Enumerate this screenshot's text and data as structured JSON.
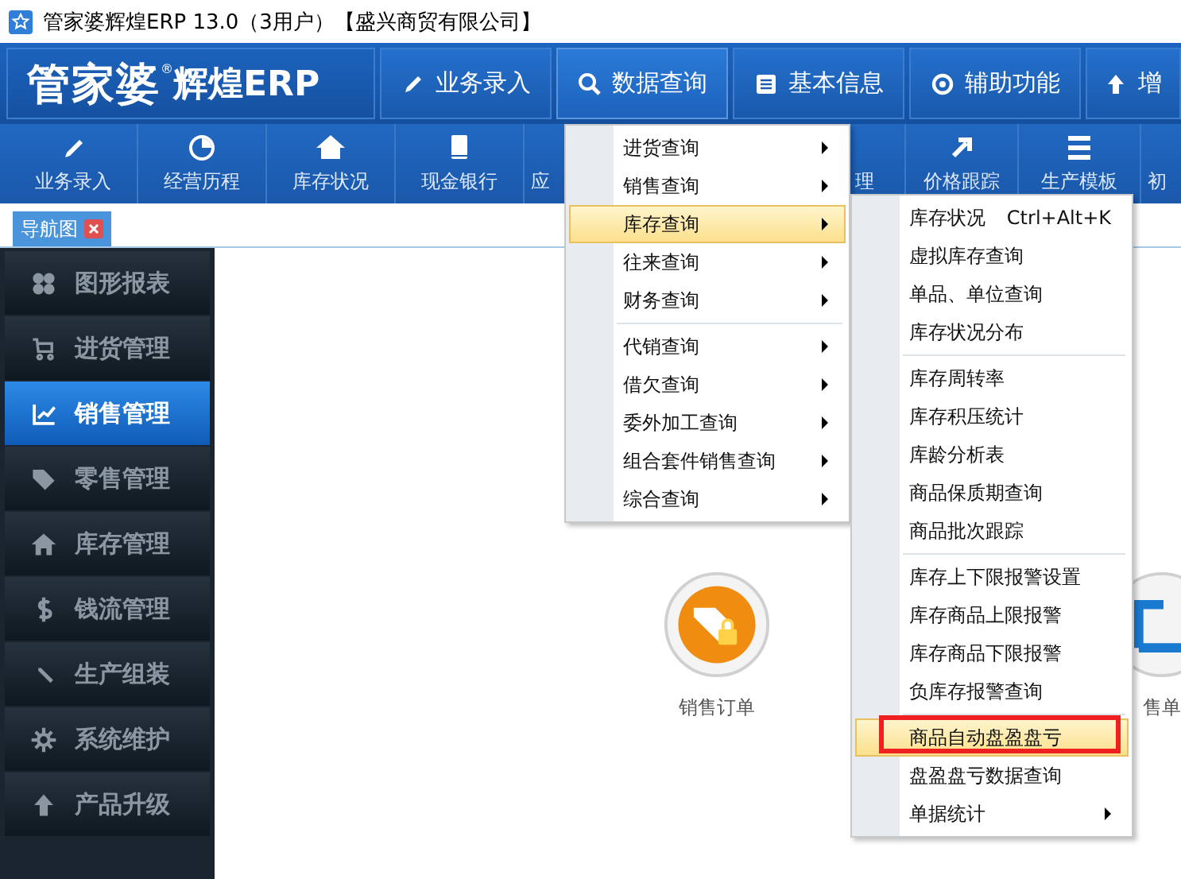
{
  "window": {
    "title": "管家婆辉煌ERP 13.0（3用户）【盛兴商贸有限公司】"
  },
  "header": {
    "logo": "管家婆",
    "logo_mark": "®",
    "logo_sub": "辉煌ERP",
    "buttons": [
      {
        "label": "业务录入",
        "selected": false
      },
      {
        "label": "数据查询",
        "selected": true
      },
      {
        "label": "基本信息",
        "selected": false
      },
      {
        "label": "辅助功能",
        "selected": false
      },
      {
        "label": "增",
        "selected": false
      }
    ]
  },
  "toolbar": {
    "items": [
      {
        "label": "业务录入"
      },
      {
        "label": "经营历程"
      },
      {
        "label": "库存状况"
      },
      {
        "label": "现金银行"
      },
      {
        "label": "应"
      },
      {
        "label": "理"
      },
      {
        "label": "价格跟踪"
      },
      {
        "label": "生产模板"
      },
      {
        "label": "初"
      }
    ]
  },
  "tabs": [
    {
      "label": "导航图",
      "selected": true
    }
  ],
  "sidebar": {
    "items": [
      {
        "label": "图形报表",
        "selected": false
      },
      {
        "label": "进货管理",
        "selected": false
      },
      {
        "label": "销售管理",
        "selected": true
      },
      {
        "label": "零售管理",
        "selected": false
      },
      {
        "label": "库存管理",
        "selected": false
      },
      {
        "label": "钱流管理",
        "selected": false
      },
      {
        "label": "生产组装",
        "selected": false
      },
      {
        "label": "系统维护",
        "selected": false
      },
      {
        "label": "产品升级",
        "selected": false
      }
    ]
  },
  "canvas": {
    "items": [
      {
        "label": "销售订单"
      },
      {
        "label": "售单"
      }
    ]
  },
  "menu": {
    "groups": [
      [
        {
          "label": "进货查询",
          "submenu": true,
          "selected": false
        },
        {
          "label": "销售查询",
          "submenu": true,
          "selected": false
        },
        {
          "label": "库存查询",
          "submenu": true,
          "selected": true
        },
        {
          "label": "往来查询",
          "submenu": true,
          "selected": false
        },
        {
          "label": "财务查询",
          "submenu": true,
          "selected": false
        }
      ],
      [
        {
          "label": "代销查询",
          "submenu": true,
          "selected": false
        },
        {
          "label": "借欠查询",
          "submenu": true,
          "selected": false
        },
        {
          "label": "委外加工查询",
          "submenu": true,
          "selected": false
        },
        {
          "label": "组合套件销售查询",
          "submenu": true,
          "selected": false
        },
        {
          "label": "综合查询",
          "submenu": true,
          "selected": false
        }
      ]
    ]
  },
  "submenu": {
    "groups": [
      [
        {
          "label": "库存状况",
          "shortcut": "Ctrl+Alt+K",
          "submenu": false,
          "selected": false,
          "marked": false
        },
        {
          "label": "虚拟库存查询",
          "submenu": false,
          "selected": false,
          "marked": false
        },
        {
          "label": "单品、单位查询",
          "submenu": false,
          "selected": false,
          "marked": false
        },
        {
          "label": "库存状况分布",
          "submenu": false,
          "selected": false,
          "marked": false
        }
      ],
      [
        {
          "label": "库存周转率",
          "submenu": false,
          "selected": false,
          "marked": false
        },
        {
          "label": "库存积压统计",
          "submenu": false,
          "selected": false,
          "marked": false
        },
        {
          "label": "库龄分析表",
          "submenu": false,
          "selected": false,
          "marked": false
        },
        {
          "label": "商品保质期查询",
          "submenu": false,
          "selected": false,
          "marked": false
        },
        {
          "label": "商品批次跟踪",
          "submenu": false,
          "selected": false,
          "marked": false
        }
      ],
      [
        {
          "label": "库存上下限报警设置",
          "submenu": false,
          "selected": false,
          "marked": false
        },
        {
          "label": "库存商品上限报警",
          "submenu": false,
          "selected": false,
          "marked": false
        },
        {
          "label": "库存商品下限报警",
          "submenu": false,
          "selected": false,
          "marked": false
        },
        {
          "label": "负库存报警查询",
          "submenu": false,
          "selected": false,
          "marked": false
        }
      ],
      [
        {
          "label": "商品自动盘盈盘亏",
          "submenu": false,
          "selected": true,
          "marked": true
        },
        {
          "label": "盘盈盘亏数据查询",
          "submenu": false,
          "selected": false,
          "marked": false
        },
        {
          "label": "单据统计",
          "submenu": true,
          "selected": false,
          "marked": false
        }
      ]
    ]
  }
}
